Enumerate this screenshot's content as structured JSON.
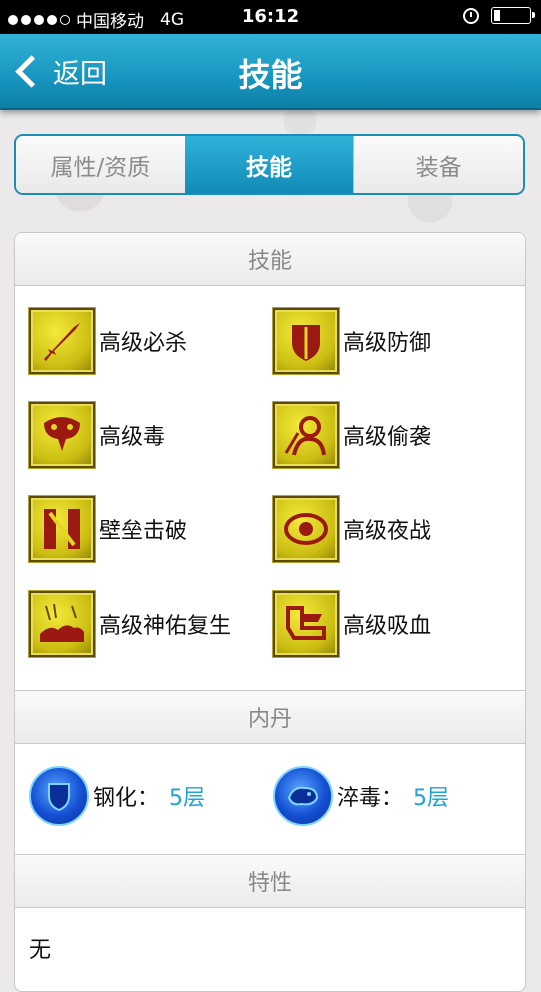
{
  "status_bar": {
    "carrier": "中国移动",
    "network": "4G",
    "time": "16:12",
    "signal_bars_filled": 4,
    "signal_bars_total": 5
  },
  "nav": {
    "back_label": "返回",
    "title": "技能"
  },
  "tabs": [
    {
      "label": "属性/资质",
      "active": false
    },
    {
      "label": "技能",
      "active": true
    },
    {
      "label": "装备",
      "active": false
    }
  ],
  "skills_section": {
    "title": "技能",
    "items": [
      {
        "label": "高级必杀",
        "icon": "sword-icon"
      },
      {
        "label": "高级防御",
        "icon": "shield-icon"
      },
      {
        "label": "高级毒",
        "icon": "snake-icon"
      },
      {
        "label": "高级偷袭",
        "icon": "sneak-attack-icon"
      },
      {
        "label": "壁垒击破",
        "icon": "barrier-break-icon"
      },
      {
        "label": "高级夜战",
        "icon": "eye-icon"
      },
      {
        "label": "高级神佑复生",
        "icon": "revival-icon"
      },
      {
        "label": "高级吸血",
        "icon": "blood-suck-icon"
      }
    ]
  },
  "neidan_section": {
    "title": "内丹",
    "items": [
      {
        "label": "钢化：",
        "value": "5层",
        "icon": "shield-orb-icon"
      },
      {
        "label": "淬毒：",
        "value": "5层",
        "icon": "poison-orb-icon"
      }
    ]
  },
  "traits_section": {
    "title": "特性",
    "text": "无"
  },
  "colors": {
    "accent": "#1795bf",
    "value_blue": "#1ca3d7",
    "skill_icon_yellow": "#e3d620",
    "skill_icon_red": "#9a1a12"
  }
}
